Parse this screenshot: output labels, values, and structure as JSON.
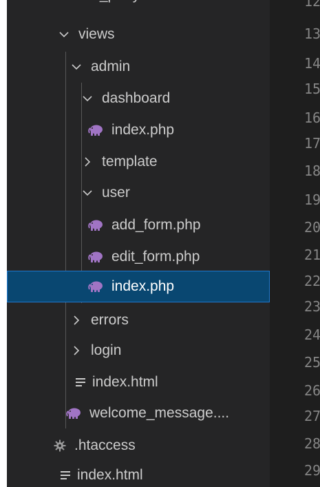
{
  "explorer": {
    "partial_top_label": "third_party",
    "items": [
      {
        "label": "views",
        "kind": "folder",
        "expanded": true
      },
      {
        "label": "admin",
        "kind": "folder",
        "expanded": true
      },
      {
        "label": "dashboard",
        "kind": "folder",
        "expanded": true
      },
      {
        "label": "index.php",
        "kind": "php"
      },
      {
        "label": "template",
        "kind": "folder",
        "expanded": false
      },
      {
        "label": "user",
        "kind": "folder",
        "expanded": true
      },
      {
        "label": "add_form.php",
        "kind": "php"
      },
      {
        "label": "edit_form.php",
        "kind": "php"
      },
      {
        "label": "index.php",
        "kind": "php",
        "selected": true
      },
      {
        "label": "errors",
        "kind": "folder",
        "expanded": false
      },
      {
        "label": "login",
        "kind": "folder",
        "expanded": false
      },
      {
        "label": "index.html",
        "kind": "html"
      },
      {
        "label": "welcome_message....",
        "kind": "php"
      },
      {
        "label": ".htaccess",
        "kind": "config"
      },
      {
        "label": "index.html",
        "kind": "html"
      }
    ]
  },
  "editor": {
    "line_numbers": [
      "12",
      "13",
      "14",
      "15",
      "16",
      "17",
      "18",
      "19",
      "20",
      "21",
      "22",
      "23",
      "24",
      "25",
      "26",
      "27",
      "28",
      "29"
    ]
  },
  "colors": {
    "sidebar_bg": "#252526",
    "editor_bg": "#1e1e1e",
    "selection_bg": "#094771",
    "selection_border": "#1f7ad1",
    "text": "#cccccc",
    "line_number": "#858585",
    "php_icon": "#a074c4"
  },
  "icons": {
    "expanded": "chevron-down-icon",
    "collapsed": "chevron-right-icon",
    "php": "php-elephant-icon",
    "html": "lines-icon",
    "config": "gear-icon"
  }
}
